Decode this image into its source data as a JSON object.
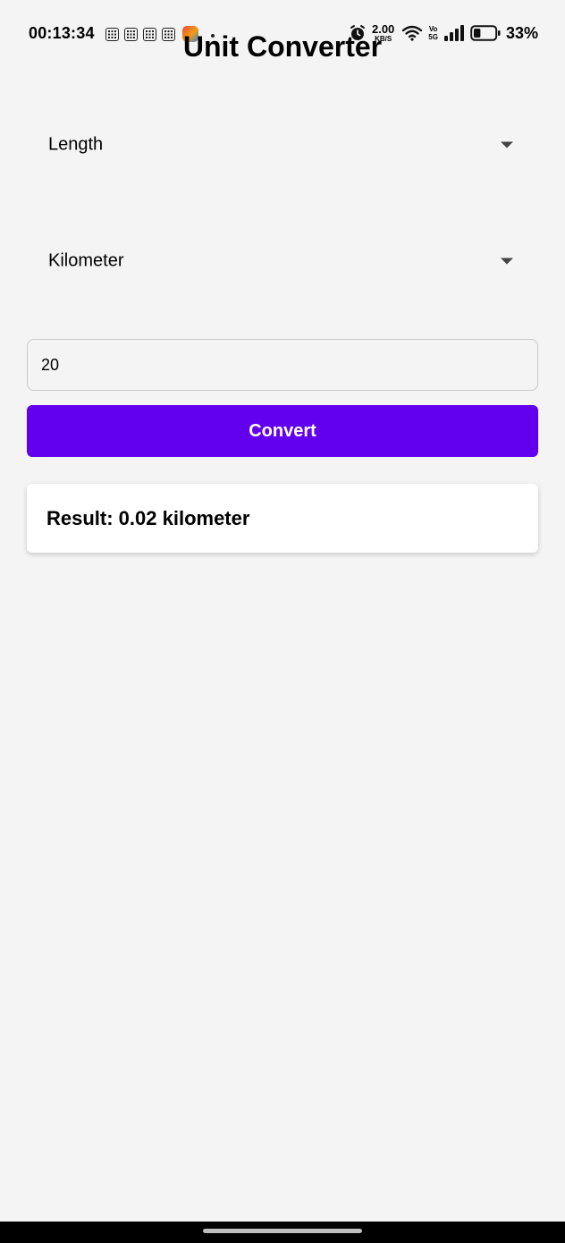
{
  "status_bar": {
    "time": "00:13:34",
    "network_speed_value": "2.00",
    "network_speed_unit": "KB/S",
    "volte_top": "Vo",
    "volte_bottom": "5G",
    "battery_percent": "33%",
    "battery_level": 0.33,
    "icons": [
      "notification-grid-icon",
      "notification-grid-icon",
      "notification-grid-icon",
      "notification-grid-icon",
      "app-notification-icon",
      "alarm-icon",
      "wifi-icon",
      "signal-icon",
      "battery-icon"
    ]
  },
  "app": {
    "title": "Unit Converter"
  },
  "category_dropdown": {
    "selected": "Length"
  },
  "unit_dropdown": {
    "selected": "Kilometer"
  },
  "value_input": {
    "value": "20"
  },
  "convert_button": {
    "label": "Convert",
    "color": "#6200ee"
  },
  "result": {
    "text": "Result: 0.02 kilometer"
  }
}
